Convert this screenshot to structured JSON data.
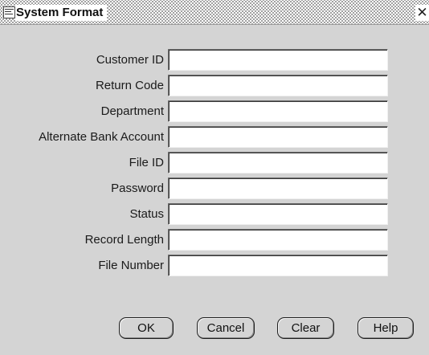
{
  "window": {
    "title": "System Format",
    "close_glyph": "✕",
    "app_icon": "oracle-document-icon",
    "close_icon": "close-icon"
  },
  "form": {
    "fields": [
      {
        "label": "Customer ID",
        "value": ""
      },
      {
        "label": "Return Code",
        "value": ""
      },
      {
        "label": "Department",
        "value": ""
      },
      {
        "label": "Alternate Bank Account",
        "value": ""
      },
      {
        "label": "File ID",
        "value": ""
      },
      {
        "label": "Password",
        "value": ""
      },
      {
        "label": "Status",
        "value": ""
      },
      {
        "label": "Record Length",
        "value": ""
      },
      {
        "label": "File Number",
        "value": ""
      }
    ]
  },
  "buttons": {
    "ok": "OK",
    "cancel": "Cancel",
    "clear": "Clear",
    "help": "Help"
  }
}
